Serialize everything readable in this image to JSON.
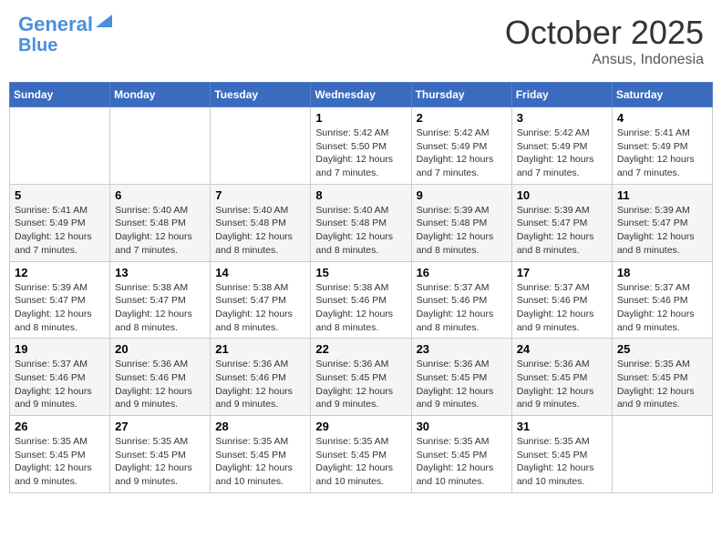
{
  "header": {
    "logo_line1": "General",
    "logo_line2": "Blue",
    "month": "October 2025",
    "location": "Ansus, Indonesia"
  },
  "weekdays": [
    "Sunday",
    "Monday",
    "Tuesday",
    "Wednesday",
    "Thursday",
    "Friday",
    "Saturday"
  ],
  "weeks": [
    [
      {
        "day": "",
        "info": ""
      },
      {
        "day": "",
        "info": ""
      },
      {
        "day": "",
        "info": ""
      },
      {
        "day": "1",
        "info": "Sunrise: 5:42 AM\nSunset: 5:50 PM\nDaylight: 12 hours\nand 7 minutes."
      },
      {
        "day": "2",
        "info": "Sunrise: 5:42 AM\nSunset: 5:49 PM\nDaylight: 12 hours\nand 7 minutes."
      },
      {
        "day": "3",
        "info": "Sunrise: 5:42 AM\nSunset: 5:49 PM\nDaylight: 12 hours\nand 7 minutes."
      },
      {
        "day": "4",
        "info": "Sunrise: 5:41 AM\nSunset: 5:49 PM\nDaylight: 12 hours\nand 7 minutes."
      }
    ],
    [
      {
        "day": "5",
        "info": "Sunrise: 5:41 AM\nSunset: 5:49 PM\nDaylight: 12 hours\nand 7 minutes."
      },
      {
        "day": "6",
        "info": "Sunrise: 5:40 AM\nSunset: 5:48 PM\nDaylight: 12 hours\nand 7 minutes."
      },
      {
        "day": "7",
        "info": "Sunrise: 5:40 AM\nSunset: 5:48 PM\nDaylight: 12 hours\nand 8 minutes."
      },
      {
        "day": "8",
        "info": "Sunrise: 5:40 AM\nSunset: 5:48 PM\nDaylight: 12 hours\nand 8 minutes."
      },
      {
        "day": "9",
        "info": "Sunrise: 5:39 AM\nSunset: 5:48 PM\nDaylight: 12 hours\nand 8 minutes."
      },
      {
        "day": "10",
        "info": "Sunrise: 5:39 AM\nSunset: 5:47 PM\nDaylight: 12 hours\nand 8 minutes."
      },
      {
        "day": "11",
        "info": "Sunrise: 5:39 AM\nSunset: 5:47 PM\nDaylight: 12 hours\nand 8 minutes."
      }
    ],
    [
      {
        "day": "12",
        "info": "Sunrise: 5:39 AM\nSunset: 5:47 PM\nDaylight: 12 hours\nand 8 minutes."
      },
      {
        "day": "13",
        "info": "Sunrise: 5:38 AM\nSunset: 5:47 PM\nDaylight: 12 hours\nand 8 minutes."
      },
      {
        "day": "14",
        "info": "Sunrise: 5:38 AM\nSunset: 5:47 PM\nDaylight: 12 hours\nand 8 minutes."
      },
      {
        "day": "15",
        "info": "Sunrise: 5:38 AM\nSunset: 5:46 PM\nDaylight: 12 hours\nand 8 minutes."
      },
      {
        "day": "16",
        "info": "Sunrise: 5:37 AM\nSunset: 5:46 PM\nDaylight: 12 hours\nand 8 minutes."
      },
      {
        "day": "17",
        "info": "Sunrise: 5:37 AM\nSunset: 5:46 PM\nDaylight: 12 hours\nand 9 minutes."
      },
      {
        "day": "18",
        "info": "Sunrise: 5:37 AM\nSunset: 5:46 PM\nDaylight: 12 hours\nand 9 minutes."
      }
    ],
    [
      {
        "day": "19",
        "info": "Sunrise: 5:37 AM\nSunset: 5:46 PM\nDaylight: 12 hours\nand 9 minutes."
      },
      {
        "day": "20",
        "info": "Sunrise: 5:36 AM\nSunset: 5:46 PM\nDaylight: 12 hours\nand 9 minutes."
      },
      {
        "day": "21",
        "info": "Sunrise: 5:36 AM\nSunset: 5:46 PM\nDaylight: 12 hours\nand 9 minutes."
      },
      {
        "day": "22",
        "info": "Sunrise: 5:36 AM\nSunset: 5:45 PM\nDaylight: 12 hours\nand 9 minutes."
      },
      {
        "day": "23",
        "info": "Sunrise: 5:36 AM\nSunset: 5:45 PM\nDaylight: 12 hours\nand 9 minutes."
      },
      {
        "day": "24",
        "info": "Sunrise: 5:36 AM\nSunset: 5:45 PM\nDaylight: 12 hours\nand 9 minutes."
      },
      {
        "day": "25",
        "info": "Sunrise: 5:35 AM\nSunset: 5:45 PM\nDaylight: 12 hours\nand 9 minutes."
      }
    ],
    [
      {
        "day": "26",
        "info": "Sunrise: 5:35 AM\nSunset: 5:45 PM\nDaylight: 12 hours\nand 9 minutes."
      },
      {
        "day": "27",
        "info": "Sunrise: 5:35 AM\nSunset: 5:45 PM\nDaylight: 12 hours\nand 9 minutes."
      },
      {
        "day": "28",
        "info": "Sunrise: 5:35 AM\nSunset: 5:45 PM\nDaylight: 12 hours\nand 10 minutes."
      },
      {
        "day": "29",
        "info": "Sunrise: 5:35 AM\nSunset: 5:45 PM\nDaylight: 12 hours\nand 10 minutes."
      },
      {
        "day": "30",
        "info": "Sunrise: 5:35 AM\nSunset: 5:45 PM\nDaylight: 12 hours\nand 10 minutes."
      },
      {
        "day": "31",
        "info": "Sunrise: 5:35 AM\nSunset: 5:45 PM\nDaylight: 12 hours\nand 10 minutes."
      },
      {
        "day": "",
        "info": ""
      }
    ]
  ]
}
